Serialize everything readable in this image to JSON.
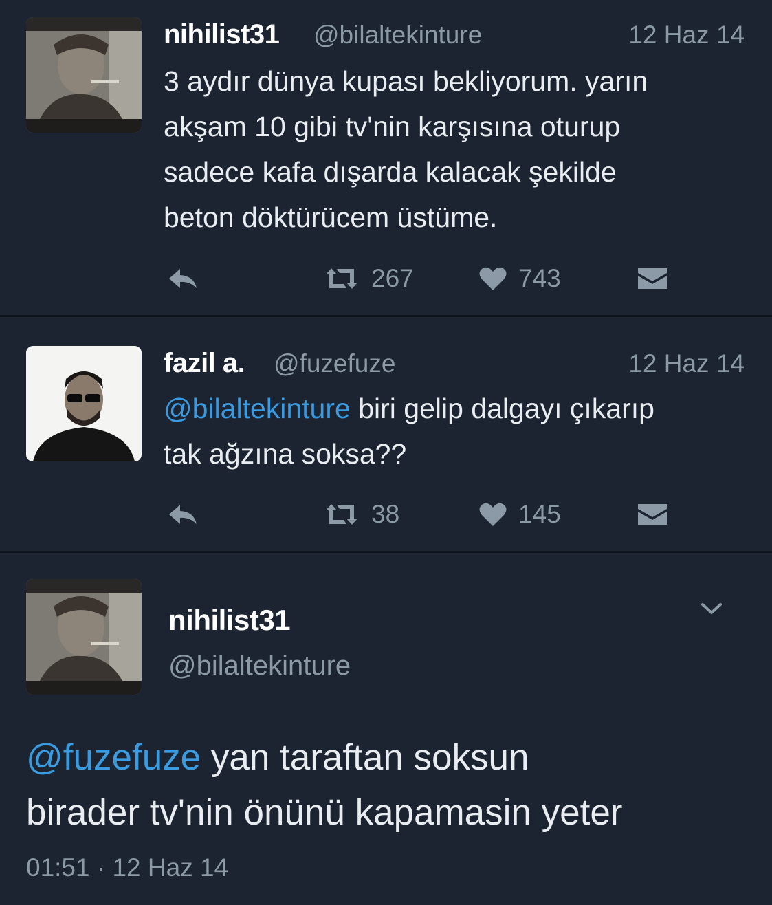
{
  "colors": {
    "background": "#1b2430",
    "divider": "#0f161e",
    "text": "#e9edf1",
    "muted": "#8c9aa8",
    "link": "#3a9be0"
  },
  "tweets": [
    {
      "name": "nihilist31",
      "handle": "@bilaltekinture",
      "date": "12 Haz 14",
      "text_lines": [
        "3 aydır dünya kupası bekliyorum. yarın",
        "akşam 10 gibi tv'nin karşısına oturup",
        "sadece kafa dışarda kalacak şekilde",
        "beton döktürücem üstüme."
      ],
      "retweets": "267",
      "likes": "743",
      "icons": [
        "reply-icon",
        "retweet-icon",
        "heart-icon",
        "dm-icon"
      ]
    },
    {
      "name": "fazil a.",
      "handle": "@fuzefuze",
      "date": "12 Haz 14",
      "mention": "@bilaltekinture",
      "text_line1": " biri gelip dalgayı çıkarıp",
      "text_line2": "tak ağzına soksa??",
      "retweets": "38",
      "likes": "145",
      "icons": [
        "reply-icon",
        "retweet-icon",
        "heart-icon",
        "dm-icon"
      ]
    }
  ],
  "detail": {
    "name": "nihilist31",
    "handle": "@bilaltekinture",
    "mention": "@fuzefuze",
    "text_line1": " yan taraftan soksun",
    "text_line2": "birader tv'nin önünü kapamasin yeter",
    "timestamp": "01:51 · 12 Haz 14",
    "menu_icon": "chevron-down-icon"
  }
}
